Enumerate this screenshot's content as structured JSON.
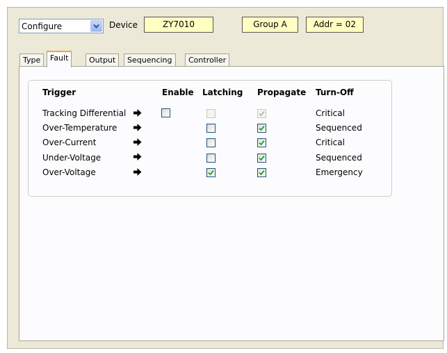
{
  "toolbar": {
    "mode_select_value": "Configure",
    "device_label": "Device",
    "device_name": "ZY7010",
    "group_name": "Group A",
    "address": "Addr = 02"
  },
  "tabs": [
    {
      "label": "Type",
      "active": false
    },
    {
      "label": "Fault",
      "active": true
    },
    {
      "label": "Output",
      "active": false
    },
    {
      "label": "Sequencing",
      "active": false
    },
    {
      "label": "Controller",
      "active": false
    }
  ],
  "fault_table": {
    "headers": {
      "trigger": "Trigger",
      "enable": "Enable",
      "latching": "Latching",
      "propagate": "Propagate",
      "turn_off": "Turn-Off"
    },
    "rows": [
      {
        "trigger": "Tracking Differential",
        "enable": "unchecked",
        "latching": "disabled-unchecked",
        "propagate": "disabled-checked",
        "turn_off": "Critical"
      },
      {
        "trigger": "Over-Temperature",
        "enable": "none",
        "latching": "unchecked",
        "propagate": "checked",
        "turn_off": "Sequenced"
      },
      {
        "trigger": "Over-Current",
        "enable": "none",
        "latching": "unchecked",
        "propagate": "checked",
        "turn_off": "Critical"
      },
      {
        "trigger": "Under-Voltage",
        "enable": "none",
        "latching": "unchecked",
        "propagate": "checked",
        "turn_off": "Sequenced"
      },
      {
        "trigger": "Over-Voltage",
        "enable": "none",
        "latching": "checked",
        "propagate": "checked",
        "turn_off": "Emergency"
      }
    ]
  },
  "icons": {
    "row_arrow": "right-arrow-icon",
    "dropdown": "chevron-down-icon",
    "check": "checkmark-icon"
  },
  "colors": {
    "window_bg": "#ece9d8",
    "panel_bg": "#fcfcfe",
    "field_bg": "#ffffc2",
    "active_tab_accent": "#f4a42a",
    "checkmark": "#21a121",
    "checkbox_border": "#1c5180"
  }
}
